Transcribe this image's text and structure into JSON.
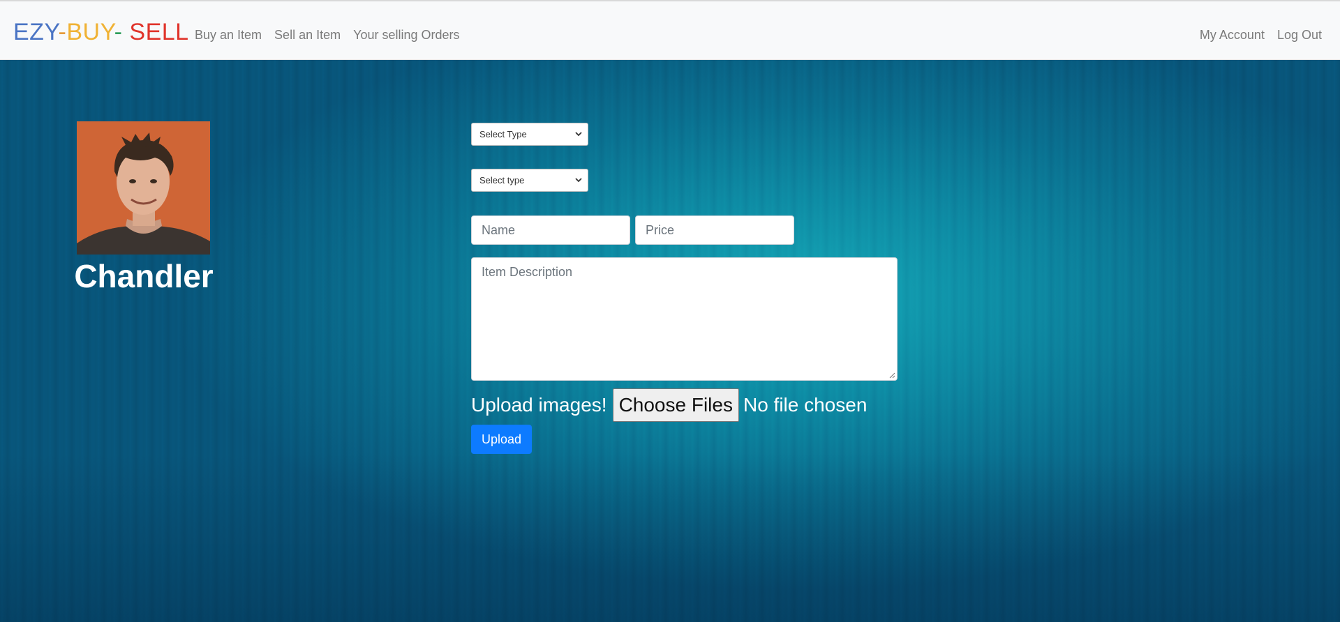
{
  "brand": {
    "part1": "EZY",
    "dash1": "-",
    "part2": "BUY",
    "dash2": "- ",
    "part3": "SELL"
  },
  "nav": {
    "left": [
      {
        "label": "Buy an Item"
      },
      {
        "label": "Sell an Item"
      },
      {
        "label": "Your selling Orders"
      }
    ],
    "right": [
      {
        "label": "My Account"
      },
      {
        "label": "Log Out"
      }
    ]
  },
  "profile": {
    "name": "Chandler"
  },
  "form": {
    "select1": {
      "selected": "Select Type"
    },
    "select2": {
      "selected": "Select type"
    },
    "name_placeholder": "Name",
    "price_placeholder": "Price",
    "description_placeholder": "Item Description",
    "upload_label": "Upload images!",
    "choose_files": "Choose Files",
    "no_file": "No file chosen",
    "upload_button": "Upload"
  },
  "colors": {
    "brand_blue": "#4a74c4",
    "brand_orange": "#f0b234",
    "brand_green": "#2e9e5b",
    "brand_red": "#e0342b",
    "primary_button": "#0d7bff"
  }
}
